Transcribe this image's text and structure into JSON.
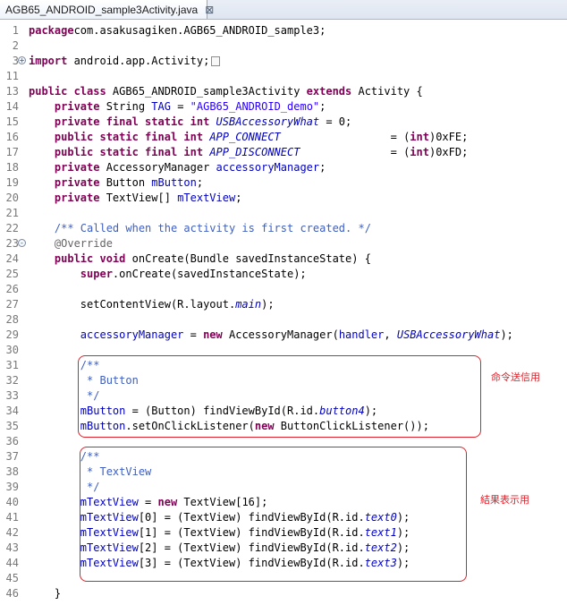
{
  "tab": {
    "label": "AGB65_ANDROID_sample3Activity.java",
    "close_glyph": "⊠"
  },
  "lines": [
    {
      "n": "1",
      "tokens": [
        [
          "kw",
          "package"
        ],
        [
          "",
          "com.asakusagiken.AGB65_ANDROID_sample3;"
        ]
      ]
    },
    {
      "n": "2",
      "tokens": []
    },
    {
      "n": "3",
      "fold": "+",
      "tokens": [
        [
          "kw",
          "import"
        ],
        [
          "",
          " android.app.Activity;"
        ]
      ],
      "folded": true
    },
    {
      "n": "11",
      "tokens": []
    },
    {
      "n": "13",
      "tokens": [
        [
          "kw",
          "public class"
        ],
        [
          "",
          " AGB65_ANDROID_sample3Activity "
        ],
        [
          "kw",
          "extends"
        ],
        [
          "",
          " Activity {"
        ]
      ]
    },
    {
      "n": "14",
      "tokens": [
        [
          "",
          "    "
        ],
        [
          "kw",
          "private"
        ],
        [
          "",
          " String "
        ],
        [
          "fld",
          "TAG"
        ],
        [
          "",
          " = "
        ],
        [
          "str",
          "\"AGB65_ANDROID_demo\""
        ],
        [
          "",
          ";"
        ]
      ]
    },
    {
      "n": "15",
      "tokens": [
        [
          "",
          "    "
        ],
        [
          "kw",
          "private final static int"
        ],
        [
          "",
          " "
        ],
        [
          "sfld",
          "USBAccessoryWhat"
        ],
        [
          "",
          " = 0;"
        ]
      ]
    },
    {
      "n": "16",
      "tokens": [
        [
          "",
          "    "
        ],
        [
          "kw",
          "public static final int"
        ],
        [
          "",
          " "
        ],
        [
          "sfld",
          "APP_CONNECT"
        ],
        [
          "",
          "                 = ("
        ],
        [
          "kw",
          "int"
        ],
        [
          "",
          ")0xFE;"
        ]
      ]
    },
    {
      "n": "17",
      "tokens": [
        [
          "",
          "    "
        ],
        [
          "kw",
          "public static final int"
        ],
        [
          "",
          " "
        ],
        [
          "sfld",
          "APP_DISCONNECT"
        ],
        [
          "",
          "              = ("
        ],
        [
          "kw",
          "int"
        ],
        [
          "",
          ")0xFD;"
        ]
      ]
    },
    {
      "n": "18",
      "tokens": [
        [
          "",
          "    "
        ],
        [
          "kw",
          "private"
        ],
        [
          "",
          " AccessoryManager "
        ],
        [
          "fld",
          "accessoryManager"
        ],
        [
          "",
          ";"
        ]
      ]
    },
    {
      "n": "19",
      "tokens": [
        [
          "",
          "    "
        ],
        [
          "kw",
          "private"
        ],
        [
          "",
          " Button "
        ],
        [
          "fld",
          "mButton"
        ],
        [
          "",
          ";"
        ]
      ]
    },
    {
      "n": "20",
      "tokens": [
        [
          "",
          "    "
        ],
        [
          "kw",
          "private"
        ],
        [
          "",
          " TextView[] "
        ],
        [
          "fld",
          "mTextView"
        ],
        [
          "",
          ";"
        ]
      ]
    },
    {
      "n": "21",
      "tokens": []
    },
    {
      "n": "22",
      "tokens": [
        [
          "",
          "    "
        ],
        [
          "cmt",
          "/** Called when the activity is first created. */"
        ]
      ]
    },
    {
      "n": "23",
      "fold": "-",
      "tokens": [
        [
          "",
          "    "
        ],
        [
          "ann",
          "@Override"
        ]
      ]
    },
    {
      "n": "24",
      "tokens": [
        [
          "",
          "    "
        ],
        [
          "kw",
          "public void"
        ],
        [
          "",
          " onCreate(Bundle savedInstanceState) {"
        ]
      ]
    },
    {
      "n": "25",
      "tokens": [
        [
          "",
          "        "
        ],
        [
          "kw",
          "super"
        ],
        [
          "",
          ".onCreate(savedInstanceState);"
        ]
      ]
    },
    {
      "n": "26",
      "tokens": []
    },
    {
      "n": "27",
      "tokens": [
        [
          "",
          "        setContentView(R.layout."
        ],
        [
          "sfld",
          "main"
        ],
        [
          "",
          ");"
        ]
      ]
    },
    {
      "n": "28",
      "tokens": []
    },
    {
      "n": "29",
      "tokens": [
        [
          "",
          "        "
        ],
        [
          "fld",
          "accessoryManager"
        ],
        [
          "",
          " = "
        ],
        [
          "kw",
          "new"
        ],
        [
          "",
          " AccessoryManager("
        ],
        [
          "fld",
          "handler"
        ],
        [
          "",
          ", "
        ],
        [
          "sfld",
          "USBAccessoryWhat"
        ],
        [
          "",
          ");"
        ]
      ]
    },
    {
      "n": "30",
      "tokens": []
    },
    {
      "n": "31",
      "tokens": [
        [
          "",
          "        "
        ],
        [
          "cmt",
          "/**"
        ]
      ]
    },
    {
      "n": "32",
      "tokens": [
        [
          "",
          "        "
        ],
        [
          "cmt",
          " * Button"
        ]
      ]
    },
    {
      "n": "33",
      "tokens": [
        [
          "",
          "        "
        ],
        [
          "cmt",
          " */"
        ]
      ]
    },
    {
      "n": "34",
      "tokens": [
        [
          "",
          "        "
        ],
        [
          "fld",
          "mButton"
        ],
        [
          "",
          " = (Button) findViewById(R.id."
        ],
        [
          "sfld",
          "button4"
        ],
        [
          "",
          ");"
        ]
      ]
    },
    {
      "n": "35",
      "tokens": [
        [
          "",
          "        "
        ],
        [
          "fld",
          "mButton"
        ],
        [
          "",
          ".setOnClickListener("
        ],
        [
          "kw",
          "new"
        ],
        [
          "",
          " ButtonClickListener());"
        ]
      ]
    },
    {
      "n": "36",
      "tokens": []
    },
    {
      "n": "37",
      "tokens": [
        [
          "",
          "        "
        ],
        [
          "cmt",
          "/**"
        ]
      ]
    },
    {
      "n": "38",
      "tokens": [
        [
          "",
          "        "
        ],
        [
          "cmt",
          " * TextView"
        ]
      ]
    },
    {
      "n": "39",
      "tokens": [
        [
          "",
          "        "
        ],
        [
          "cmt",
          " */"
        ]
      ]
    },
    {
      "n": "40",
      "tokens": [
        [
          "",
          "        "
        ],
        [
          "fld",
          "mTextView"
        ],
        [
          "",
          " = "
        ],
        [
          "kw",
          "new"
        ],
        [
          "",
          " TextView[16];"
        ]
      ]
    },
    {
      "n": "41",
      "tokens": [
        [
          "",
          "        "
        ],
        [
          "fld",
          "mTextView"
        ],
        [
          "",
          "[0] = (TextView) findViewById(R.id."
        ],
        [
          "sfld",
          "text0"
        ],
        [
          "",
          ");"
        ]
      ]
    },
    {
      "n": "42",
      "tokens": [
        [
          "",
          "        "
        ],
        [
          "fld",
          "mTextView"
        ],
        [
          "",
          "[1] = (TextView) findViewById(R.id."
        ],
        [
          "sfld",
          "text1"
        ],
        [
          "",
          ");"
        ]
      ]
    },
    {
      "n": "43",
      "tokens": [
        [
          "",
          "        "
        ],
        [
          "fld",
          "mTextView"
        ],
        [
          "",
          "[2] = (TextView) findViewById(R.id."
        ],
        [
          "sfld",
          "text2"
        ],
        [
          "",
          ");"
        ]
      ]
    },
    {
      "n": "44",
      "tokens": [
        [
          "",
          "        "
        ],
        [
          "fld",
          "mTextView"
        ],
        [
          "",
          "[3] = (TextView) findViewById(R.id."
        ],
        [
          "sfld",
          "text3"
        ],
        [
          "",
          ");"
        ]
      ]
    },
    {
      "n": "45",
      "tokens": []
    },
    {
      "n": "46",
      "tokens": [
        [
          "",
          "    }"
        ]
      ]
    }
  ],
  "annotations": [
    {
      "label": "命令送信用"
    },
    {
      "label": "結果表示用"
    }
  ],
  "colors": {
    "keyword": "#7f0055",
    "string": "#2a00ff",
    "field": "#0000c0",
    "comment": "#3f5fbf",
    "annotation": "#646464",
    "callout": "#e0202a"
  }
}
